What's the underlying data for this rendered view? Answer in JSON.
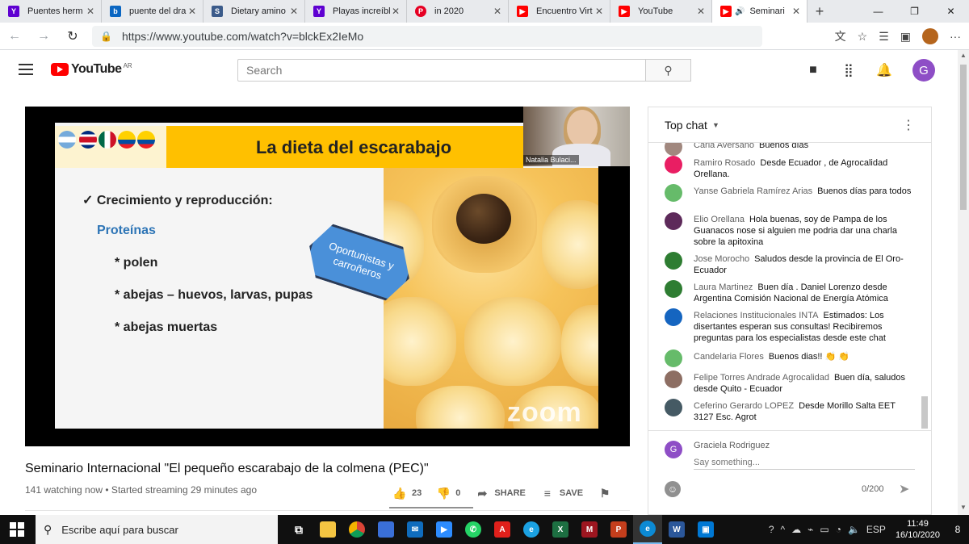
{
  "browser": {
    "tabs": [
      {
        "label": "Puentes herm",
        "icon": "yahoo-icon",
        "color": "#5f01d1"
      },
      {
        "label": "puente del dra",
        "icon": "bing-icon",
        "color": "#0a66c2"
      },
      {
        "label": "Dietary amino",
        "icon": "site-icon",
        "color": "#3b5b8a"
      },
      {
        "label": "Playas increíbl",
        "icon": "yahoo-icon",
        "color": "#5f01d1"
      },
      {
        "label": "in 2020",
        "icon": "pinterest-icon",
        "color": "#e60023"
      },
      {
        "label": "Encuentro Virt",
        "icon": "youtube-icon",
        "color": "#ff0000"
      },
      {
        "label": "YouTube",
        "icon": "youtube-icon",
        "color": "#ff0000"
      },
      {
        "label": "Seminari",
        "icon": "youtube-icon",
        "color": "#ff0000"
      }
    ],
    "url": "https://www.youtube.com/watch?v=blckEx2IeMo"
  },
  "youtube": {
    "logo_text": "YouTube",
    "country": "AR",
    "search_placeholder": "Search",
    "accent": "#ff0000",
    "user_initial": "G"
  },
  "video": {
    "slide": {
      "title": "La dieta del escarabajo",
      "main_bullet": "✓ Crecimiento y reproducción:",
      "sub_heading": "Proteínas",
      "items": [
        "* polen",
        "* abejas – huevos, larvas, pupas",
        "* abejas muertas"
      ],
      "hex_label": "Oportunistas y carroñeros",
      "watermark": "zoom"
    },
    "speaker_name": "Natalia Bulaci...",
    "title": "Seminario Internacional \"El pequeño escarabajo de la colmena (PEC)\"",
    "meta": "141 watching now • Started streaming 29 minutes ago",
    "likes": "23",
    "dislikes": "0",
    "share_label": "SHARE",
    "save_label": "SAVE"
  },
  "chat": {
    "header": "Top chat",
    "messages": [
      {
        "author": "Carla Aversano",
        "text": "Buenos días",
        "color": "#a1887f"
      },
      {
        "author": "Ramiro Rosado",
        "text": "Desde Ecuador , de Agrocalidad Orellana.",
        "color": "#e91e63"
      },
      {
        "author": "Yanse Gabriela Ramírez Arias",
        "text": "Buenos días para todos",
        "color": "#66bb6a"
      },
      {
        "author": "Elio Orellana",
        "text": "Hola buenas, soy de Pampa de los Guanacos nose si alguien me podria dar una charla sobre la apitoxina",
        "color": "#5d2a5a"
      },
      {
        "author": "Jose Morocho",
        "text": "Saludos desde la provincia de El Oro- Ecuador",
        "color": "#2e7d32"
      },
      {
        "author": "Laura Martinez",
        "text": "Buen día . Daniel Lorenzo desde Argentina Comisión Nacional de Energía Atómica",
        "color": "#2e7d32"
      },
      {
        "author": "Relaciones Institucionales INTA",
        "text": "Estimados: Los disertantes esperan sus consultas! Recibiremos preguntas para los especialistas desde este chat",
        "color": "#1565c0"
      },
      {
        "author": "Candelaria Flores",
        "text": "Buenos dias!! 👏 👏",
        "color": "#66bb6a"
      },
      {
        "author": "Felipe Torres Andrade Agrocalidad",
        "text": "Buen día, saludos desde Quito - Ecuador",
        "color": "#8d6e63"
      },
      {
        "author": "Ceferino Gerardo LOPEZ",
        "text": "Desde Morillo Salta EET 3127 Esc. Agrot",
        "color": "#455a64"
      }
    ],
    "compose_name": "Graciela Rodriguez",
    "compose_placeholder": "Say something...",
    "char_count": "0/200"
  },
  "taskbar": {
    "search_text": "Escribe aquí para buscar",
    "language": "ESP",
    "time": "11:49",
    "date": "16/10/2020",
    "notifications": "8"
  }
}
